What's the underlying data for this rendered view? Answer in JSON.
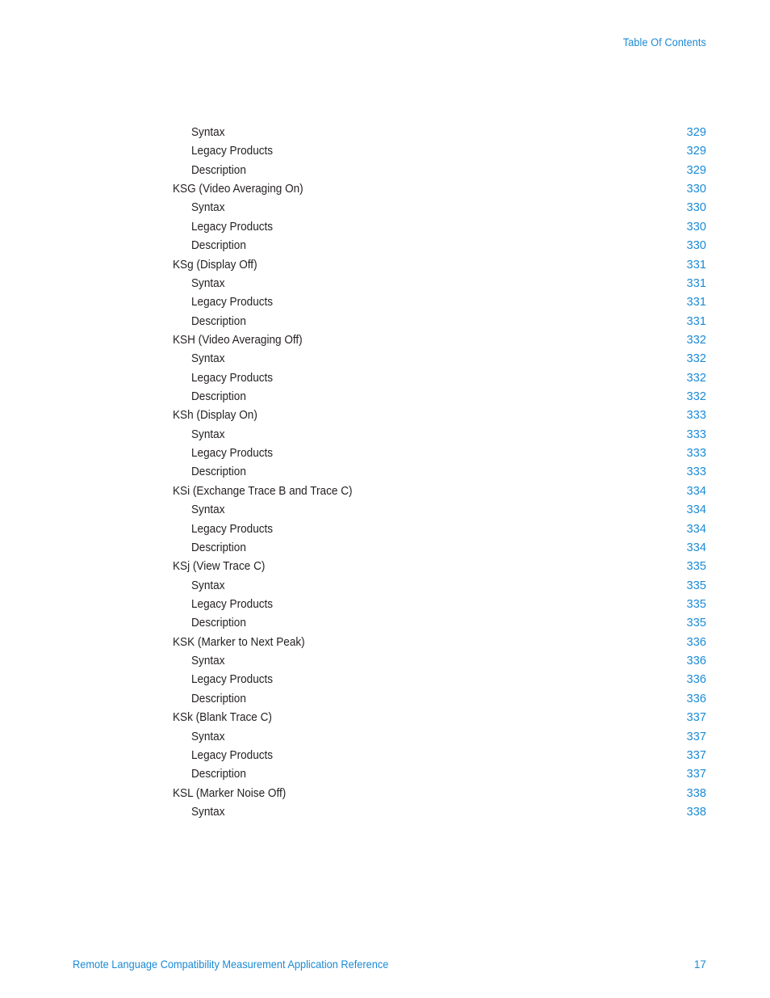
{
  "header": {
    "title": "Table Of Contents"
  },
  "footer": {
    "document_title": "Remote Language Compatibility Measurement Application Reference",
    "page_number": "17"
  },
  "colors": {
    "link_blue": "#1b8ad4",
    "body_text": "#231f20",
    "background": "#ffffff"
  },
  "toc": {
    "entries": [
      {
        "label": "Syntax",
        "page": "329",
        "level": 2
      },
      {
        "label": "Legacy Products",
        "page": "329",
        "level": 2
      },
      {
        "label": "Description",
        "page": "329",
        "level": 2
      },
      {
        "label": "KSG (Video Averaging On)",
        "page": "330",
        "level": 1
      },
      {
        "label": "Syntax",
        "page": "330",
        "level": 2
      },
      {
        "label": "Legacy Products",
        "page": "330",
        "level": 2
      },
      {
        "label": "Description",
        "page": "330",
        "level": 2
      },
      {
        "label": "KSg (Display Off)",
        "page": "331",
        "level": 1
      },
      {
        "label": "Syntax",
        "page": "331",
        "level": 2
      },
      {
        "label": "Legacy Products",
        "page": "331",
        "level": 2
      },
      {
        "label": "Description",
        "page": "331",
        "level": 2
      },
      {
        "label": "KSH (Video Averaging Off)",
        "page": "332",
        "level": 1
      },
      {
        "label": "Syntax",
        "page": "332",
        "level": 2
      },
      {
        "label": "Legacy Products",
        "page": "332",
        "level": 2
      },
      {
        "label": "Description",
        "page": "332",
        "level": 2
      },
      {
        "label": "KSh (Display On)",
        "page": "333",
        "level": 1
      },
      {
        "label": "Syntax",
        "page": "333",
        "level": 2
      },
      {
        "label": "Legacy Products",
        "page": "333",
        "level": 2
      },
      {
        "label": "Description",
        "page": "333",
        "level": 2
      },
      {
        "label": "KSi (Exchange Trace B and Trace C)",
        "page": "334",
        "level": 1
      },
      {
        "label": "Syntax",
        "page": "334",
        "level": 2
      },
      {
        "label": "Legacy Products",
        "page": "334",
        "level": 2
      },
      {
        "label": "Description",
        "page": "334",
        "level": 2
      },
      {
        "label": "KSj (View Trace C)",
        "page": "335",
        "level": 1
      },
      {
        "label": "Syntax",
        "page": "335",
        "level": 2
      },
      {
        "label": "Legacy Products",
        "page": "335",
        "level": 2
      },
      {
        "label": "Description",
        "page": "335",
        "level": 2
      },
      {
        "label": "KSK (Marker to Next Peak)",
        "page": "336",
        "level": 1
      },
      {
        "label": "Syntax",
        "page": "336",
        "level": 2
      },
      {
        "label": "Legacy Products",
        "page": "336",
        "level": 2
      },
      {
        "label": "Description",
        "page": "336",
        "level": 2
      },
      {
        "label": "KSk (Blank Trace C)",
        "page": "337",
        "level": 1
      },
      {
        "label": "Syntax",
        "page": "337",
        "level": 2
      },
      {
        "label": "Legacy Products",
        "page": "337",
        "level": 2
      },
      {
        "label": "Description",
        "page": "337",
        "level": 2
      },
      {
        "label": "KSL (Marker Noise Off)",
        "page": "338",
        "level": 1
      },
      {
        "label": "Syntax",
        "page": "338",
        "level": 2
      }
    ]
  }
}
